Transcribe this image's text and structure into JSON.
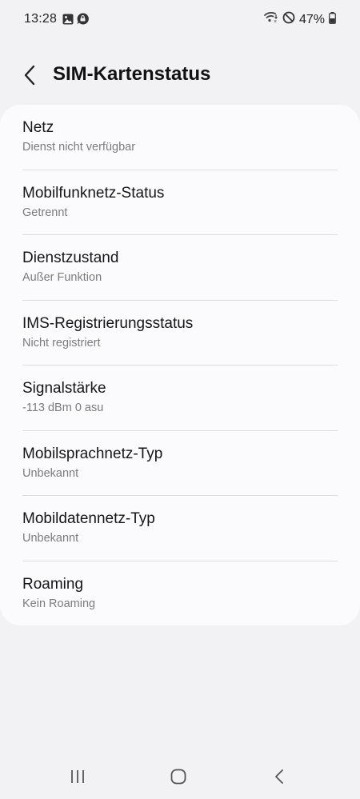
{
  "status_bar": {
    "time": "13:28",
    "left_icons": [
      "image-icon",
      "chat-bubble-icon"
    ],
    "right_icons": [
      "wifi-icon",
      "do-not-disturb-icon",
      "battery-icon"
    ],
    "battery_percent": "47%"
  },
  "header": {
    "title": "SIM-Kartenstatus",
    "back_icon": "chevron-left-icon"
  },
  "items": [
    {
      "title": "Netz",
      "subtitle": "Dienst nicht verfügbar"
    },
    {
      "title": "Mobilfunknetz-Status",
      "subtitle": "Getrennt"
    },
    {
      "title": "Dienstzustand",
      "subtitle": "Außer Funktion"
    },
    {
      "title": "IMS-Registrierungsstatus",
      "subtitle": "Nicht registriert"
    },
    {
      "title": "Signalstärke",
      "subtitle": "-113 dBm 0 asu"
    },
    {
      "title": "Mobilsprachnetz-Typ",
      "subtitle": "Unbekannt"
    },
    {
      "title": "Mobildatennetz-Typ",
      "subtitle": "Unbekannt"
    },
    {
      "title": "Roaming",
      "subtitle": "Kein Roaming"
    }
  ],
  "nav_bar": {
    "recents_icon": "recents-icon",
    "home_icon": "home-icon",
    "back_icon": "back-icon"
  },
  "colors": {
    "background": "#f2f2f5",
    "card": "#fbfbfd",
    "divider": "#dcdcdf",
    "subtitle": "#7b7b80"
  }
}
